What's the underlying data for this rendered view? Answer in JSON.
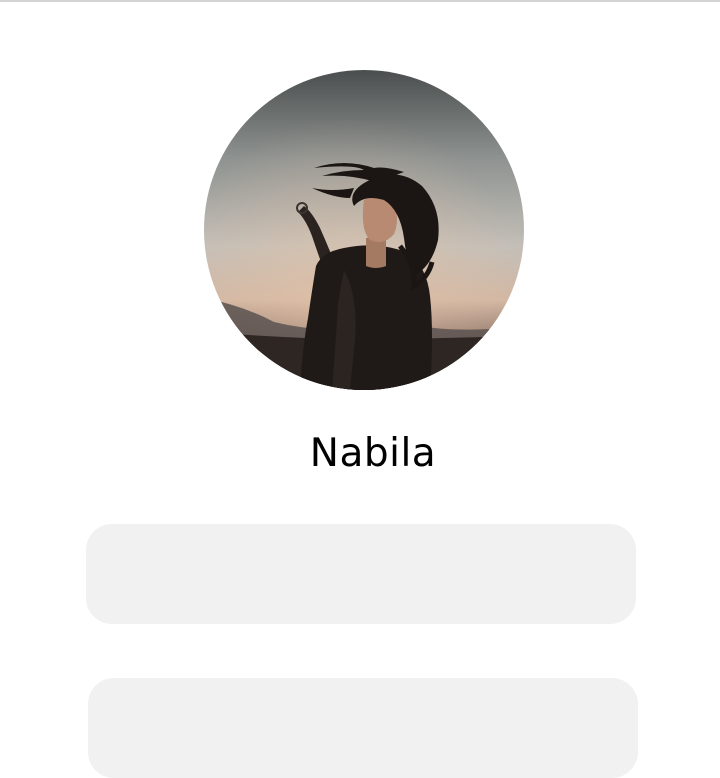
{
  "profile": {
    "name": "Nabila",
    "avatar_icon": "profile-photo"
  },
  "fields": [
    {
      "value": ""
    },
    {
      "value": ""
    }
  ],
  "colors": {
    "background": "#ffffff",
    "field_background": "#f1f1f1",
    "text": "#000000"
  }
}
